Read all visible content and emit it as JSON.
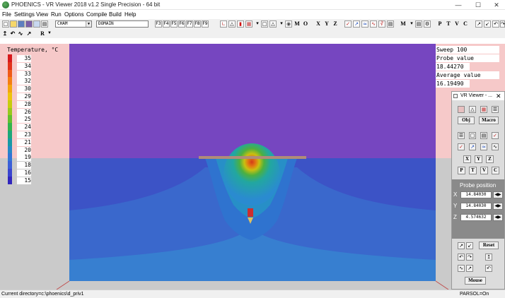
{
  "window": {
    "title": "PHOENICS - VR Viewer 2018 v1.2 Single Precision - 64 bit",
    "minimize": "—",
    "maximize": "☐",
    "close": "✕"
  },
  "menu": [
    "File",
    "Settings",
    "View",
    "Run",
    "Options",
    "Compile",
    "Build",
    "Help"
  ],
  "toolbar": {
    "combo1": "CHAM",
    "combo2": "DOMAIN",
    "fkeys": [
      "F3",
      "F4",
      "F5",
      "F6",
      "F7",
      "F8",
      "F9"
    ],
    "letters": [
      "M",
      "O",
      "X",
      "Y",
      "Z",
      "M",
      "P",
      "T",
      "V",
      "C"
    ],
    "r_dropdown": "R"
  },
  "legend": {
    "title": "Temperature, °C",
    "values": [
      "35",
      "34",
      "33",
      "32",
      "30",
      "29",
      "28",
      "26",
      "25",
      "24",
      "23",
      "21",
      "20",
      "19",
      "18",
      "16",
      "15"
    ],
    "colors": [
      "#d7191c",
      "#e2321a",
      "#ef5a17",
      "#f57e11",
      "#f4a40c",
      "#eec30c",
      "#c7cc0e",
      "#98c81c",
      "#63bf2e",
      "#34b44c",
      "#1ea77a",
      "#199aa4",
      "#2688c6",
      "#3275d6",
      "#3b5fd8",
      "#3a45cf",
      "#3126bd"
    ]
  },
  "info": {
    "sweep": "Sweep 100",
    "probe_label": "Probe value",
    "probe_value": "18.44270",
    "avg_label": "Average value",
    "avg_value": "16.19490"
  },
  "vr_panel": {
    "title": "VR Viewer - ...",
    "obj_button": "Obj",
    "macro_button": "Macro",
    "probe_title": "Probe position",
    "x_label": "X",
    "y_label": "Y",
    "z_label": "Z",
    "x_value": "14.84030",
    "y_value": "14.84030",
    "z_value": "4.574632",
    "reset_button": "Reset",
    "mouse_button": "Mouse",
    "xyz_buttons": [
      "X",
      "Y",
      "Z"
    ],
    "ptvc_buttons": [
      "P",
      "T",
      "V",
      "C"
    ]
  },
  "status": {
    "left": "Current directory=c:\\phoenics\\d_priv1",
    "right": "PARSOL=On"
  }
}
